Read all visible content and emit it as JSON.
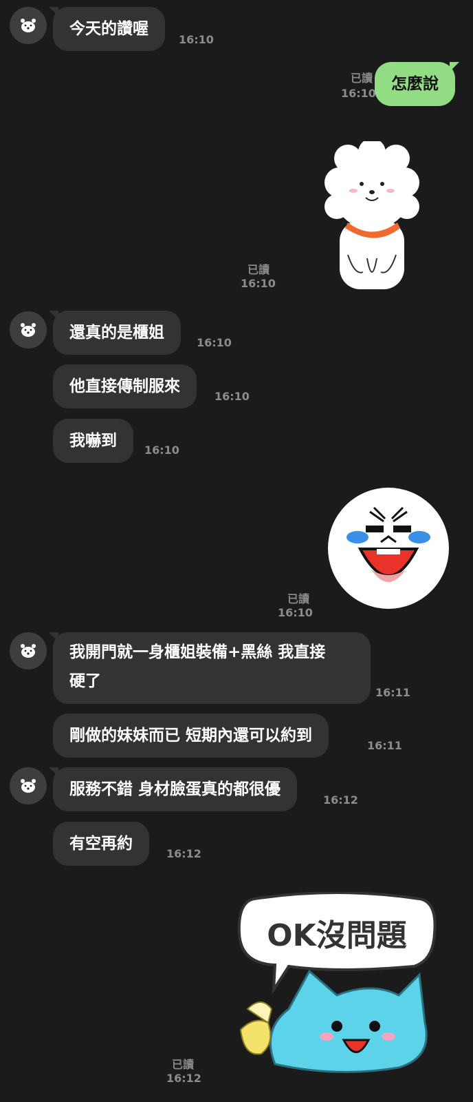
{
  "messages": [
    {
      "text": "今天的讚喔",
      "time": "16:10"
    },
    {
      "text": "怎麼說",
      "time": "16:10",
      "read": "已讀"
    },
    {
      "sticker": "white-fluffy-dog-sticker",
      "time": "16:10",
      "read": "已讀"
    },
    {
      "text": "還真的是櫃姐",
      "time": "16:10"
    },
    {
      "text": "他直接傳制服來",
      "time": "16:10"
    },
    {
      "text": "我嚇到",
      "time": "16:10"
    },
    {
      "sticker": "laughing-crying-face-sticker",
      "time": "16:10",
      "read": "已讀"
    },
    {
      "text_line1": "我開門就一身櫃姐裝備+黑絲 我直接",
      "text_line2": "硬了",
      "time": "16:11"
    },
    {
      "text": "剛做的妹妹而已  短期內還可以約到",
      "time": "16:11"
    },
    {
      "text": "服務不錯 身材臉蛋真的都很優",
      "time": "16:12"
    },
    {
      "text": "有空再約",
      "time": "16:12"
    },
    {
      "sticker": "blue-cat-ok-sticker",
      "sticker_text": "OK沒問題",
      "time": "16:12",
      "read": "已讀"
    }
  ],
  "colors": {
    "background": "#1b1b1b",
    "incoming_bubble": "#333333",
    "outgoing_bubble": "#92dd84",
    "meta": "#8c8c8c"
  }
}
